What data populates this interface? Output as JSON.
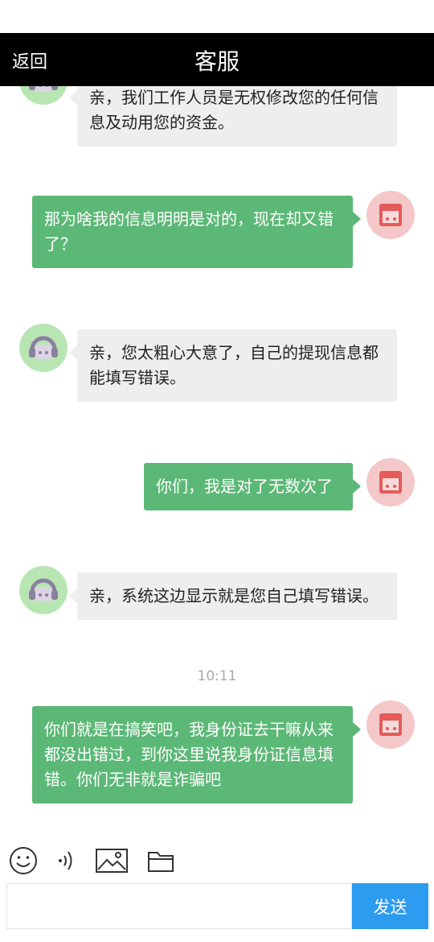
{
  "header": {
    "back_label": "返回",
    "title": "客服"
  },
  "messages": [
    {
      "sender": "agent",
      "text": "亲，我们工作人员是无权修改您的任何信息及动用您的资金。"
    },
    {
      "sender": "user",
      "text": "那为啥我的信息明明是对的，现在却又错了？"
    },
    {
      "sender": "agent",
      "text": "亲，您太粗心大意了，自己的提现信息都能填写错误。"
    },
    {
      "sender": "user",
      "text": "你们，我是对了无数次了"
    },
    {
      "sender": "agent",
      "text": "亲，系统这边显示就是您自己填写错误。"
    },
    {
      "sender": "user",
      "text": "你们就是在搞笑吧，我身份证去干嘛从来都没出错过，到你这里说我身份证信息填错。你们无非就是诈骗吧"
    }
  ],
  "timestamp": "10:11",
  "toolbar": {
    "icons": [
      "emoji-icon",
      "voice-icon",
      "image-icon",
      "folder-icon"
    ]
  },
  "composer": {
    "input_value": "",
    "send_label": "发送"
  },
  "colors": {
    "header_bg": "#000000",
    "agent_bubble": "#eeeeee",
    "user_bubble": "#5cb876",
    "send_button": "#2d9bf0",
    "agent_avatar_bg": "#b8e6b3",
    "user_avatar_bg": "#f4c8c8"
  }
}
